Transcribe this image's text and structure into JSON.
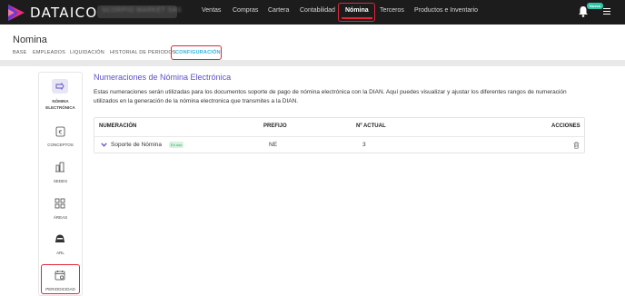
{
  "app": {
    "brand": "DATAICO",
    "company_name": "SCORPIO MARKET SAS",
    "brand_colors": {
      "topbar": "#1c1c1c",
      "logo_pink": "#e3307c",
      "logo_purple": "#6a3ad6",
      "accent_red": "#e0263a",
      "accent_purple": "#5b50c8",
      "accent_cyan": "#2eb3d9"
    }
  },
  "topnav": {
    "items": [
      "Ventas",
      "Compras",
      "Cartera",
      "Contabilidad",
      "Nómina",
      "Terceros",
      "Productos e Inventario"
    ],
    "active": "Nómina",
    "notification_badge": "Nuevo",
    "icons": [
      "bell-icon",
      "menu-icon"
    ]
  },
  "page": {
    "title": "Nomina",
    "tabs": [
      "BASE",
      "EMPLEADOS",
      "LIQUIDACIÓN",
      "HISTORIAL DE PERIODOS",
      "CONFIGURACIÓN"
    ],
    "active_tab": "CONFIGURACIÓN"
  },
  "rail": {
    "items": [
      {
        "label_line1": "NÓMINA",
        "label_line2": "ELECTRÓNICA",
        "icon": "document-icon",
        "active": true
      },
      {
        "label_line1": "CONCEPTOS",
        "icon": "cash-icon"
      },
      {
        "label_line1": "SEDES",
        "icon": "building-icon"
      },
      {
        "label_line1": "ÁREAS",
        "icon": "grid-icon"
      },
      {
        "label_line1": "ARL",
        "icon": "helmet-icon"
      },
      {
        "label_line1": "PERIODICIDAD",
        "icon": "calendar-icon"
      }
    ]
  },
  "content": {
    "section_title": "Numeraciones de Nómina Electrónica",
    "description": "Estas numeraciones serán utilizadas para los documentos soporte de pago de nómina electrónica con la DIAN. Aquí puedes visualizar y ajustar los diferentes rangos de numeración utilizados en la generación de la nómina electronica que transmites a la DIAN.",
    "table": {
      "headers": [
        "NUMERACIÓN",
        "PREFIJO",
        "Nº ACTUAL",
        "ACCIONES"
      ],
      "rows": [
        {
          "numeracion": "Soporte de Nómina",
          "status": "En uso",
          "prefijo": "NE",
          "actual": "3"
        }
      ]
    }
  }
}
